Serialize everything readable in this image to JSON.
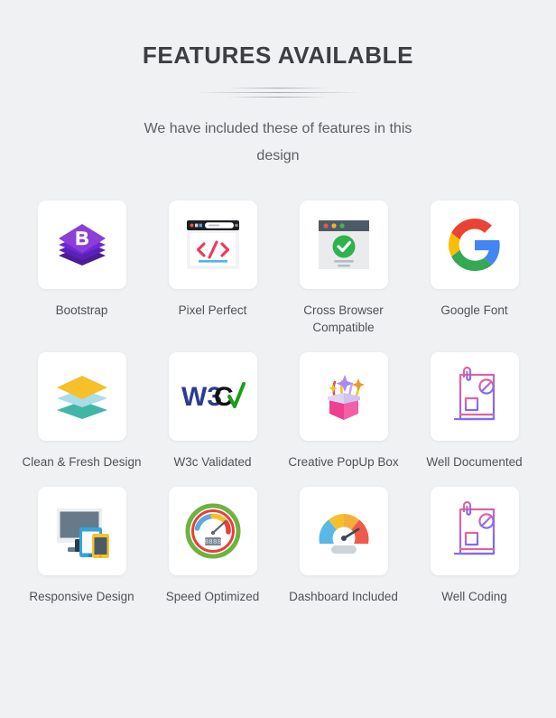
{
  "header": {
    "title": "FEATURES AVAILABLE",
    "subtitle": "We have included these of features in this design"
  },
  "colors": {
    "background": "#eff1f3",
    "card": "#ffffff",
    "title": "#3c3f41",
    "label": "#4f5255",
    "bootstrap_purple": "#8a3ffc",
    "code_red": "#f2385a",
    "code_blue": "#49b7e8",
    "check_green": "#2eb34c",
    "google_red": "#ea4335",
    "google_yellow": "#fbbc05",
    "google_green": "#34a853",
    "google_blue": "#4285f4",
    "layer_yellow": "#f6c02b",
    "layer_lightblue": "#a9dde8",
    "layer_teal": "#41b6a6",
    "w3c_blue": "#2b3b8f",
    "w3c_black": "#111111",
    "w3c_green": "#18a018",
    "box_pink": "#f2449b",
    "doc_pink": "#f8618e",
    "doc_purple": "#7b6cf6",
    "device_gray": "#667a89",
    "device_blue": "#35a3de",
    "device_yellow": "#f7c22e",
    "gauge_green": "#6db33f",
    "gauge_red": "#e8403a"
  },
  "features": [
    {
      "label": "Bootstrap",
      "icon": "bootstrap-logo-icon"
    },
    {
      "label": "Pixel Perfect",
      "icon": "browser-code-icon"
    },
    {
      "label": "Cross Browser Compatible",
      "icon": "browser-check-icon"
    },
    {
      "label": "Google Font",
      "icon": "google-g-logo-icon"
    },
    {
      "label": "Clean & Fresh Design",
      "icon": "stacked-layers-icon"
    },
    {
      "label": "W3c Validated",
      "icon": "w3c-validated-icon"
    },
    {
      "label": "Creative PopUp Box",
      "icon": "gift-box-sparkles-icon"
    },
    {
      "label": "Well Documented",
      "icon": "document-report-icon"
    },
    {
      "label": "Responsive Design",
      "icon": "multi-device-icon"
    },
    {
      "label": "Speed Optimized",
      "icon": "speedometer-ring-icon"
    },
    {
      "label": "Dashboard Included",
      "icon": "gauge-dashboard-icon"
    },
    {
      "label": "Well Coding",
      "icon": "document-report-icon"
    }
  ]
}
